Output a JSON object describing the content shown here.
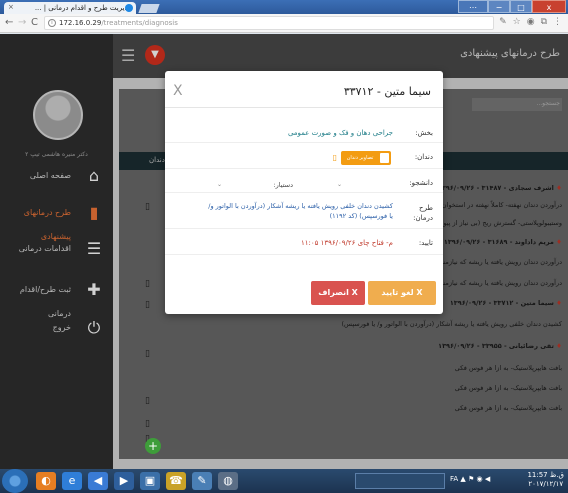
{
  "browser": {
    "tab_title": "مدیریت طرح و اقدام درمانی | ...",
    "tab_close": "×",
    "url_host": "172.16.0.29",
    "url_path": "/treatments/diagnosis",
    "nav": {
      "back": "←",
      "forward": "→",
      "reload": "C"
    },
    "info": "i",
    "window_controls": {
      "user": "⋯",
      "minimize": "−",
      "maximize": "□",
      "close": "x"
    },
    "extensions": [
      "✎",
      "☆",
      "◉",
      "⧉",
      "⋮"
    ]
  },
  "sidebar": {
    "username": "دکتر منیره هاشمی تیپ ۲",
    "items": [
      {
        "label": "صفحه اصلی",
        "icon": "home-icon",
        "glyph": "⌂"
      },
      {
        "label": "طرح درمانهای پیشنهادی",
        "icon": "document-icon",
        "glyph": "▮"
      },
      {
        "label": "اقدامات درمانی",
        "icon": "list-icon",
        "glyph": "☰"
      },
      {
        "label": "ثبت طرح/اقدام درمانی",
        "icon": "plus-icon",
        "glyph": "✚"
      },
      {
        "label": "خروج",
        "icon": "power-icon",
        "glyph": "⏻"
      }
    ],
    "add_glyph": "+"
  },
  "main": {
    "title": "طرح درمانهای پیشنهادی",
    "hamburger": "☰",
    "bell": "▼",
    "search_placeholder": "جستجو...",
    "dentist_header": "دندان",
    "rows": [
      {
        "text": "اشرف سجادی - ۳۱۴۸۷ - ۱۳۹۶/۰۹/۲۶",
        "bold": true
      },
      {
        "text": "درآوردن دندان نهفته- کاملاً نهفته در استخوان",
        "bold": false
      },
      {
        "text": "وستیبولوپلاستی- گسترش ریج (بی نیاز از پیوند تخونه)",
        "bold": false
      },
      {
        "text": "مریم داداوند - ۳۱۶۸۹ - ۱۳۹۶/۰۹/۲۶",
        "bold": true
      },
      {
        "text": "درآوردن دندان رویش یافته یا ریشه که نیازمند کنارزدن فلپ",
        "bold": false
      },
      {
        "text": "درآوردن دندان رویش یافته یا ریشه که نیازمند کنارزدن فلپ",
        "bold": false
      },
      {
        "text": "سیما متین - ۳۳۷۱۲ - ۱۳۹۶/۰۹/۲۶",
        "bold": true
      },
      {
        "text": "کشیدن دندان خلفی رویش یافته یا ریشه آشکار (درآوردن با الواتور و/ یا فورسپس)",
        "bold": false
      },
      {
        "text": "تقی رضائیانی - ۳۳۹۵۵ - ۱۳۹۶/۰۹/۲۶",
        "bold": true
      },
      {
        "text": "بافت هایپرپلاستیک- به ازا هر فوس فکی",
        "bold": false
      },
      {
        "text": "بافت هایپرپلاستیک- به ازا هر فوس فکی",
        "bold": false
      },
      {
        "text": "بافت هایپرپلاستیک- به ازا هر فوس فکی",
        "bold": false
      }
    ],
    "row_icons": [
      "▯",
      "▯",
      "▯",
      "▯",
      "▯",
      "▯",
      "▯"
    ]
  },
  "modal": {
    "close": "X",
    "title": "سیما متین - ۳۳۷۱۲",
    "fields": {
      "section_label": "بخش:",
      "section_value": "جراحی دهان و فک و صورت عمومی",
      "tooth_label": "دندان:",
      "tooth_button": "تصاویر دندان",
      "student_label": "دانشجو:",
      "student_value": "دستیار:",
      "plan_label": "طرح درمان:",
      "plan_value": "کشیدن دندان خلفی رویش یافته یا ریشه آشکار (درآوردن با الواتور و/ یا فورسپس) (کد ۱۱۹۲)",
      "confirm_label": "تایید:",
      "confirm_value": "م- فتاح چای ۱۳۹۶/۰۹/۲۶ ۱۱:۰۵"
    },
    "ok_button": "X لغو تایید",
    "cancel_button": "X انصراف"
  },
  "taskbar": {
    "apps": [
      "◐",
      "e",
      "◀",
      "▶",
      "▣",
      "☎",
      "✎",
      "◍"
    ],
    "tray": "FA ▲ ⚑ ◉ ◀",
    "time": "11:57 ق.ظ",
    "date": "۲۰۱۷/۱۲/۱۷"
  }
}
